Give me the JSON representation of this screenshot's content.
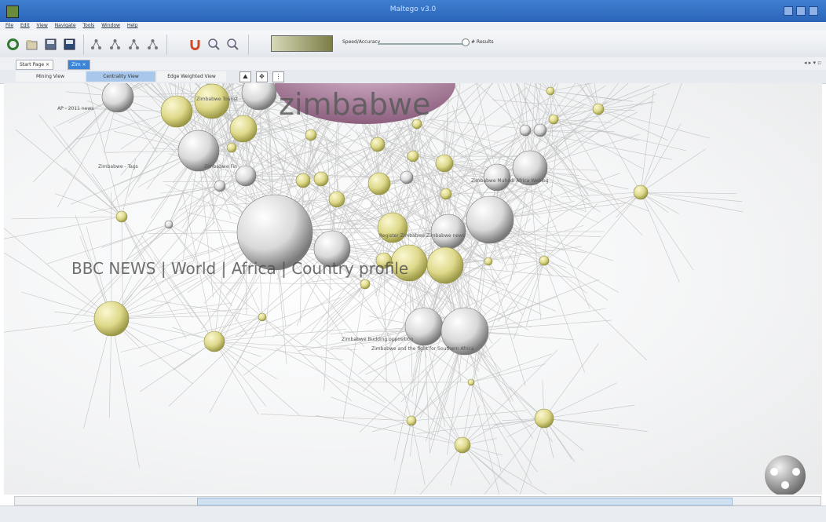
{
  "window": {
    "title": "Maltego v3.0"
  },
  "menu": [
    "File",
    "Edit",
    "View",
    "Navigate",
    "Tools",
    "Window",
    "Help"
  ],
  "toolbar": {
    "slider_label": "Speed/Accuracy",
    "results_label": "# Results"
  },
  "doc_tabs": [
    "Start Page",
    "Zim"
  ],
  "view_tabs": [
    "Mining View",
    "Centrality View",
    "Edge Weighted View"
  ],
  "view_icons": [
    "tree-layout-icon",
    "radial-layout-icon",
    "hierarchy-layout-icon"
  ],
  "graph": {
    "big_label_1": "zimbabwe",
    "big_label_2": "BBC NEWS | World | Africa | Country profile",
    "small_labels": [
      "AP - 2011 news",
      "Zimbabwe - Tags",
      "Zimbabwe Fin",
      "Zimbabwe Tourist",
      "Zimbabwe Muhadi Africa Weblog",
      "Zimbabwe Budding opposition",
      "Zimbabwe and the fight for Southern Africa",
      "Register Zimbabwe Zimbabwe news"
    ]
  }
}
